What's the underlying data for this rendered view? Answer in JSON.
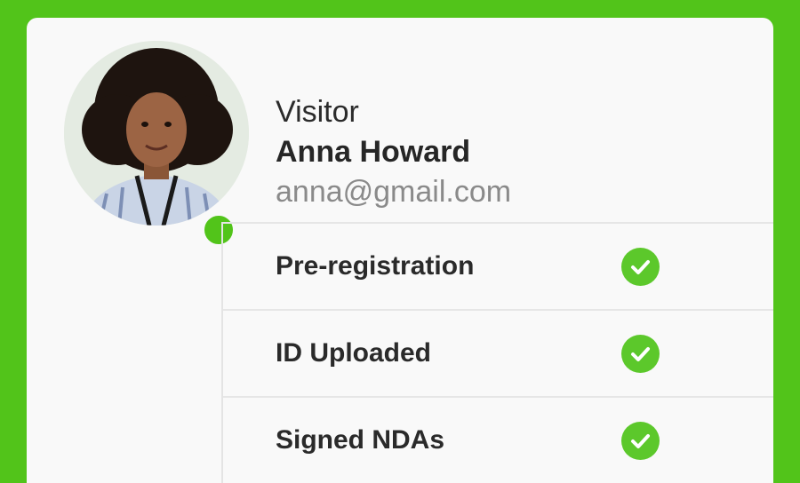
{
  "visitor": {
    "role": "Visitor",
    "name": "Anna Howard",
    "email": "anna@gmail.com",
    "online": true
  },
  "steps": [
    {
      "label": "Pre-registration",
      "done": true
    },
    {
      "label": "ID Uploaded",
      "done": true
    },
    {
      "label": "Signed NDAs",
      "done": true
    }
  ],
  "colors": {
    "brand_green": "#52c41a",
    "check_green": "#5cc82b",
    "card_bg": "#f9f9f9"
  },
  "icons": {
    "status": "online-status-dot",
    "step_done": "check-circle-icon"
  }
}
